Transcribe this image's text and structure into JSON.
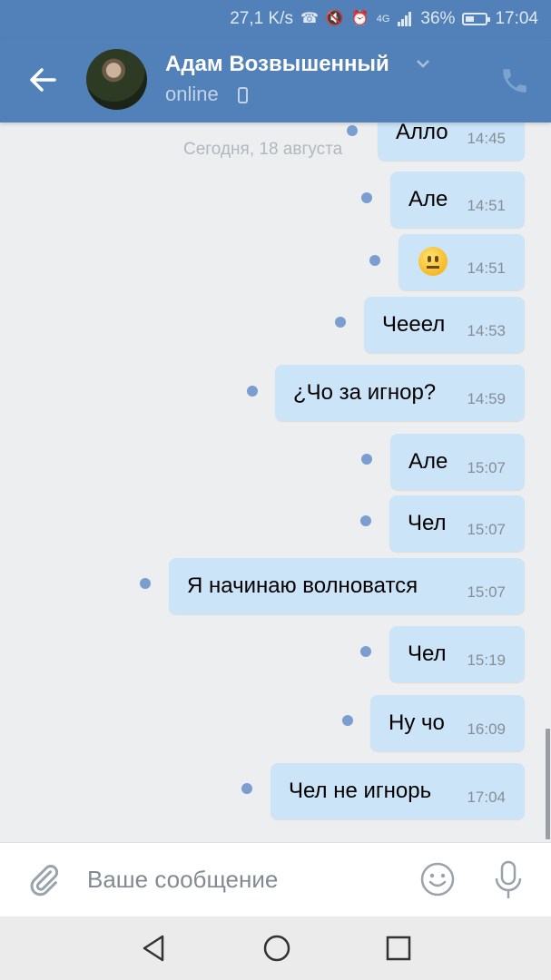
{
  "status_bar": {
    "speed": "27,1 K/s",
    "network": "4G",
    "battery": "36%",
    "time": "17:04"
  },
  "header": {
    "contact_name": "Адам Возвышенный",
    "presence": "online"
  },
  "chat": {
    "date_separator": "Сегодня, 18 августа",
    "messages": [
      {
        "text": "Алло",
        "time": "14:45"
      },
      {
        "text": "Але",
        "time": "14:51"
      },
      {
        "text": "",
        "emoji": "neutral-face",
        "time": "14:51"
      },
      {
        "text": "Чееел",
        "time": "14:53"
      },
      {
        "text": "¿Чо за игнор?",
        "time": "14:59"
      },
      {
        "text": "Але",
        "time": "15:07"
      },
      {
        "text": "Чел",
        "time": "15:07"
      },
      {
        "text": "Я начинаю волноватся",
        "time": "15:07"
      },
      {
        "text": "Чел",
        "time": "15:19"
      },
      {
        "text": "Ну чо",
        "time": "16:09"
      },
      {
        "text": "Чел не игнорь",
        "time": "17:04"
      }
    ]
  },
  "composer": {
    "placeholder": "Ваше сообщение",
    "value": ""
  },
  "colors": {
    "header": "#5181b8",
    "bubble_outgoing": "#cce4f7",
    "unread_dot": "#7b9ed0",
    "chat_background": "#edeef0"
  }
}
